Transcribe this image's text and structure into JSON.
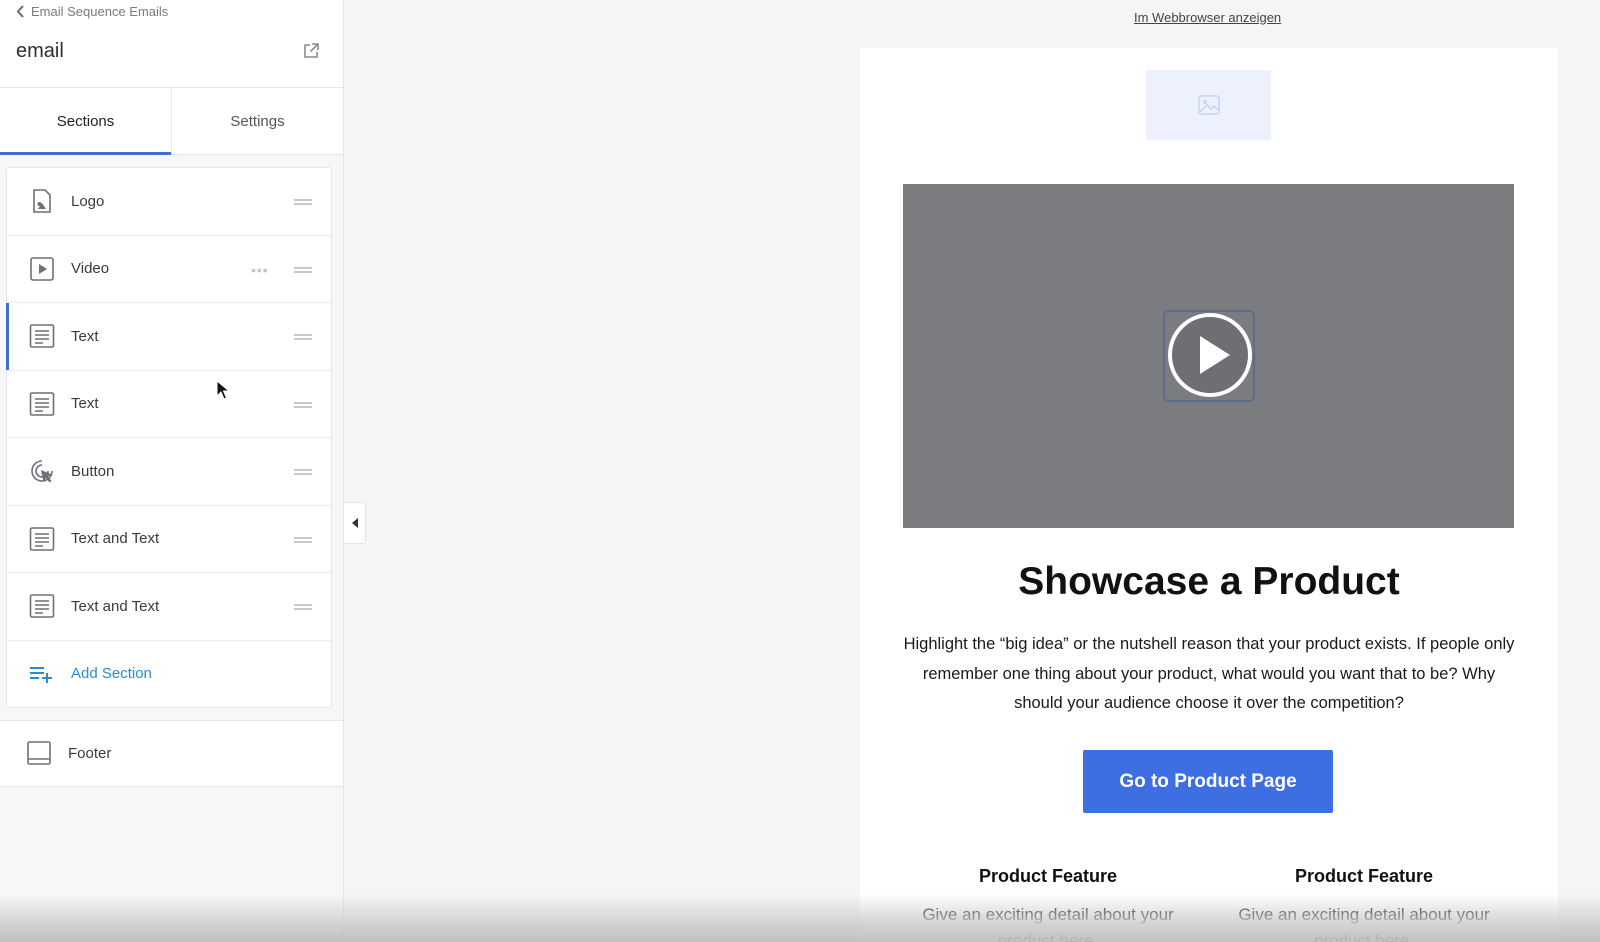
{
  "sidebar": {
    "back_label": "Email Sequence Emails",
    "title": "email",
    "tabs": [
      {
        "label": "Sections",
        "active": true
      },
      {
        "label": "Settings",
        "active": false
      }
    ],
    "sections": [
      {
        "label": "Logo",
        "icon": "image-icon"
      },
      {
        "label": "Video",
        "icon": "video-play-icon"
      },
      {
        "label": "Text",
        "icon": "text-icon"
      },
      {
        "label": "Text",
        "icon": "text-icon"
      },
      {
        "label": "Button",
        "icon": "cursor-click-icon"
      },
      {
        "label": "Text and Text",
        "icon": "text-icon"
      },
      {
        "label": "Text and Text",
        "icon": "text-icon"
      }
    ],
    "add_section_label": "Add Section",
    "footer_label": "Footer"
  },
  "preview": {
    "web_link": "Im Webbrowser anzeigen",
    "headline": "Showcase a Product",
    "body": "Highlight the “big idea” or the nutshell reason that your product exists. If people only remember one thing about your product, what would you want that to be? Why should your audience choose it over the competition?",
    "cta_label": "Go to Product Page",
    "features": [
      {
        "title": "Product Feature",
        "desc": "Give an exciting detail about your product here."
      },
      {
        "title": "Product Feature",
        "desc": "Give an exciting detail about your product here."
      }
    ]
  },
  "colors": {
    "accent": "#3f6fc9",
    "link": "#2c8bd0",
    "cta": "#3d6fe3",
    "video_bg": "#7b7c80"
  }
}
